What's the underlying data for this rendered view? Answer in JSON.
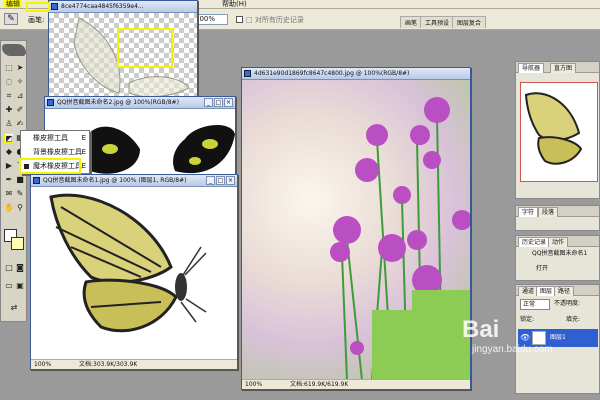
{
  "menubar": {
    "items": [
      "帮助(H)",
      "编辑"
    ]
  },
  "options": {
    "mode_label": "画笔:",
    "zoom_value": "100%",
    "history_checkbox_label": "□ 对所有历史记录",
    "tabs": [
      "画笔",
      "工具预设",
      "图层复合"
    ]
  },
  "toolbox": {
    "foreground_color": "#ffffff",
    "background_color": "#fffbb0"
  },
  "windows": {
    "back": {
      "title": "8ce4774caa4845f6359e4...",
      "zoom": "100%"
    },
    "qq1": {
      "title": "QQ拼音截图未命名2.jpg @ 100%(RGB/8#)"
    },
    "qq2": {
      "title": "QQ拼音截图未命名1.jpg @ 100% (图层1, RGB/8#)",
      "status_zoom": "100%",
      "status_doc": "文档:303.9K/303.9K"
    },
    "flower": {
      "title": "4d631e90d1869fc8647c4800.jpg @ 100%(RGB/8#)",
      "status_zoom": "100%",
      "status_doc": "文档:619.9K/619.9K"
    }
  },
  "context_menu": {
    "items": [
      {
        "label": "橡皮擦工具",
        "key": "E"
      },
      {
        "label": "背景橡皮擦工具",
        "key": "E"
      },
      {
        "label": "魔术橡皮擦工具",
        "key": "E"
      }
    ]
  },
  "navigator": {
    "tabs": [
      "导航器",
      "直方图"
    ]
  },
  "char_panel": {
    "tabs": [
      "字符",
      "段落"
    ]
  },
  "history": {
    "tabs": [
      "历史记录",
      "动作"
    ],
    "items": [
      "QQ拼音截图未命名1",
      "打开"
    ]
  },
  "layers": {
    "tabs": [
      "通道",
      "图层",
      "路径"
    ],
    "blend_mode": "正常",
    "opacity_label": "不透明度:",
    "lock_label": "锁定:",
    "fill_label": "填充:",
    "layer_name": "图层1"
  },
  "watermark": {
    "line1": "Bai",
    "line2": "jingyan.baidu.com"
  },
  "colors": {
    "highlight": "#f7f200",
    "selection": "#2f5fd0",
    "title_gradient": "#b9c9e6"
  }
}
